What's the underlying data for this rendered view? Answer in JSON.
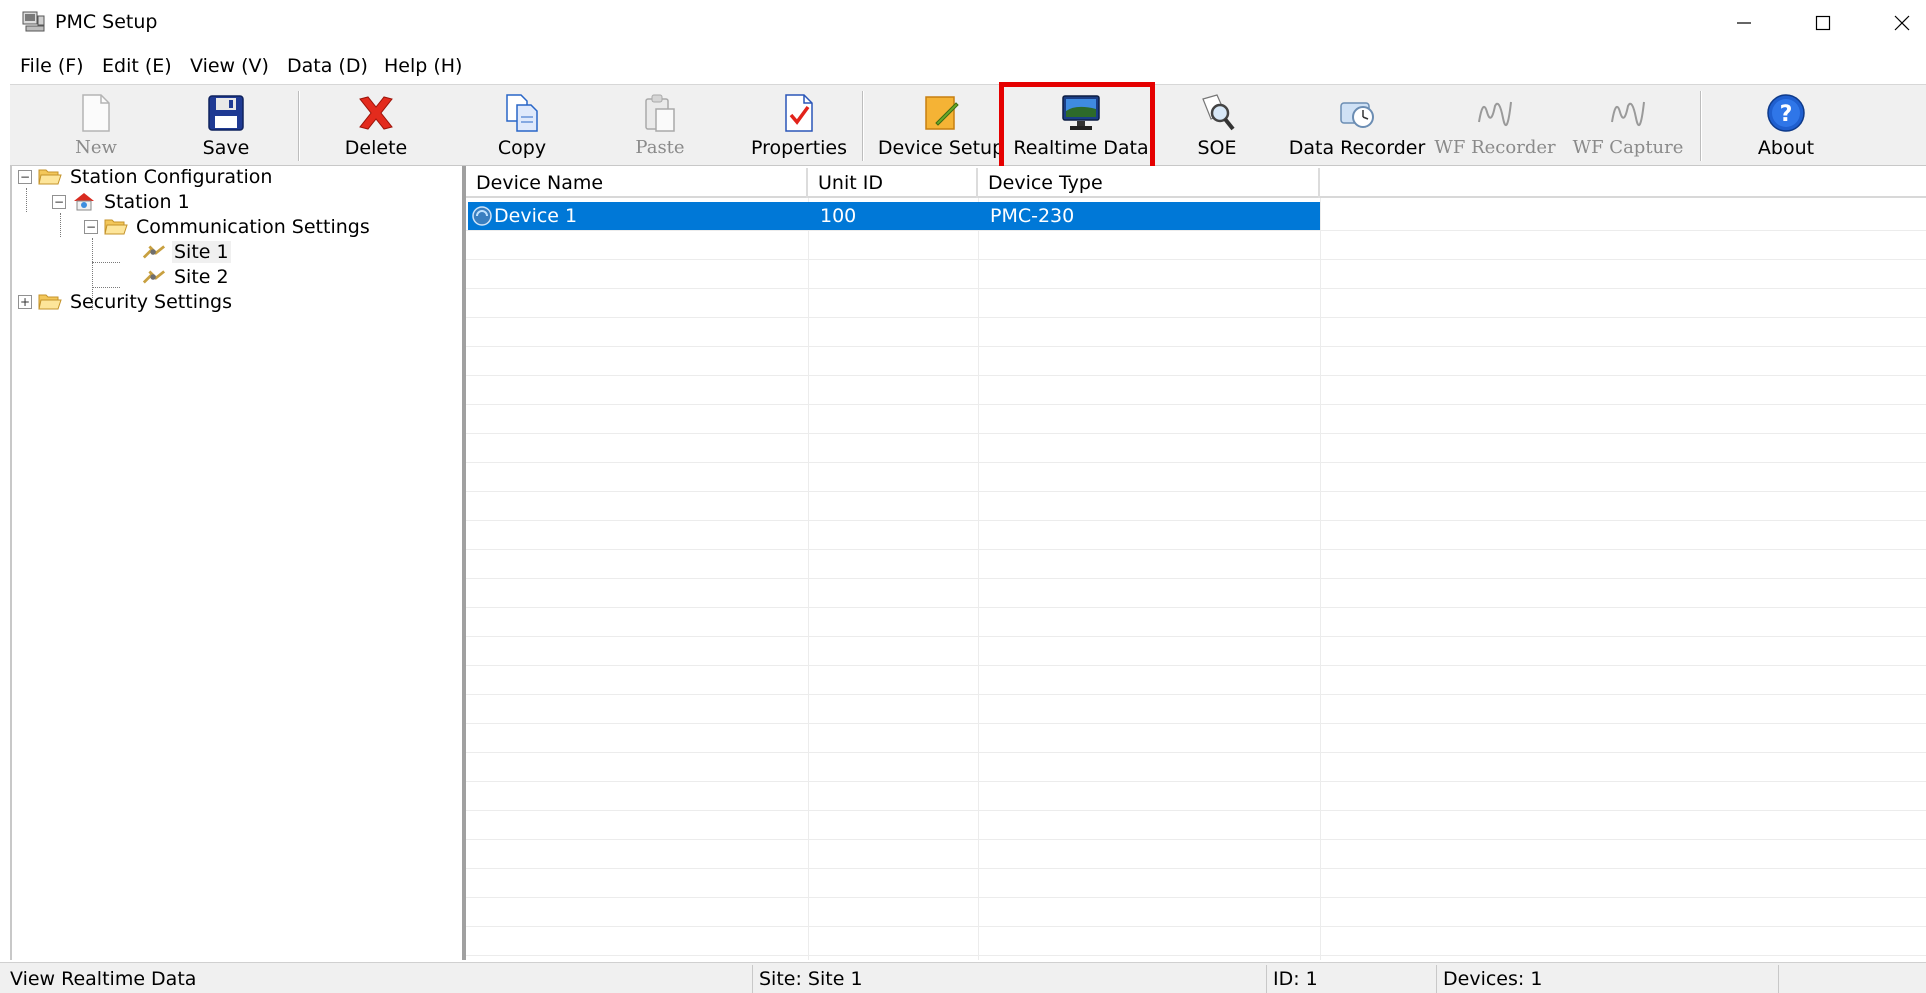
{
  "window": {
    "title": "PMC Setup"
  },
  "menu": [
    "File (F)",
    "Edit (E)",
    "View (V)",
    "Data (D)",
    "Help (H)"
  ],
  "toolbar": {
    "new": "New",
    "save": "Save",
    "delete": "Delete",
    "copy": "Copy",
    "paste": "Paste",
    "properties": "Properties",
    "device_setup": "Device Setup",
    "realtime_data": "Realtime Data",
    "soe": "SOE",
    "data_recorder": "Data Recorder",
    "wf_recorder": "WF Recorder",
    "wf_capture": "WF Capture",
    "about": "About"
  },
  "tree": {
    "station_configuration": "Station Configuration",
    "station_1": "Station 1",
    "communication_settings": "Communication Settings",
    "site_1": "Site 1",
    "site_2": "Site 2",
    "security_settings": "Security Settings"
  },
  "device_list": {
    "columns": [
      "Device Name",
      "Unit ID",
      "Device Type"
    ],
    "rows": [
      {
        "name": "Device 1",
        "unit_id": "100",
        "type": "PMC-230"
      }
    ]
  },
  "status": {
    "message": "View Realtime Data",
    "site": "Site: Site 1",
    "id": "ID: 1",
    "devices": "Devices: 1"
  },
  "colors": {
    "selection": "#0078d7",
    "highlight": "#e50000"
  }
}
